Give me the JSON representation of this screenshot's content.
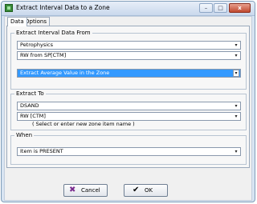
{
  "window": {
    "title": "Extract Interval Data to a Zone",
    "controls": {
      "minimize": "–",
      "maximize": "□",
      "close": "x"
    }
  },
  "tabs": [
    {
      "label": "Data",
      "active": true
    },
    {
      "label": "Options",
      "active": false
    }
  ],
  "extract_from": {
    "title": "Extract Interval Data From",
    "source": "Petrophysics",
    "curve": "RW from SP[CTM]",
    "method": "Extract Average Value in the Zone"
  },
  "extract_to": {
    "title": "Extract To",
    "zone": "DSAND",
    "item": "RW  [CTM]",
    "hint": "( Select or enter new zone item name )"
  },
  "when": {
    "title": "When",
    "condition": "Item is PRESENT"
  },
  "buttons": {
    "cancel": "Cancel",
    "ok": "OK"
  },
  "icons": {
    "app": "app-icon",
    "cancel": "x-icon",
    "ok": "check-icon",
    "dropdown": "chevron-down-icon"
  },
  "colors": {
    "selection": "#3399ff",
    "cancel_icon": "#7b2c8f"
  }
}
